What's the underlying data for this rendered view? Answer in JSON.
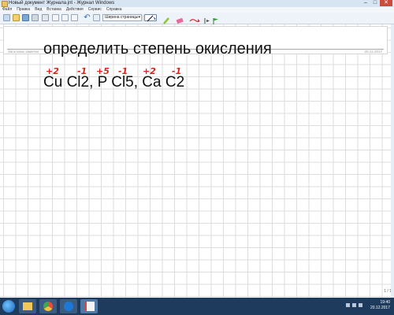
{
  "window": {
    "title": "Новый документ Журнала.jnt - Журнал Windows",
    "minimize": "–",
    "maximize": "□",
    "close": "✕"
  },
  "menu": [
    "Файл",
    "Правка",
    "Вид",
    "Вставка",
    "Действия",
    "Сервис",
    "Справка"
  ],
  "toolbar": {
    "zoom_label": "Ширина страницы",
    "icons": [
      "new-icon",
      "open-icon",
      "save-icon",
      "find-icon",
      "cut-icon",
      "copy-icon",
      "paste-icon",
      "undo-icon",
      "redo-icon",
      "pen-icon",
      "highlighter-icon",
      "eraser-icon",
      "selection-icon",
      "insert-space-icon",
      "flag-icon"
    ]
  },
  "note": {
    "title_placeholder": "Заголовок заметки",
    "date": "20.12.2017",
    "heading": "определить степень окисления",
    "formula": "Cu Cl2, P Cl5,  Ca C2",
    "oxidation_marks": [
      "+2",
      "-1",
      "+5",
      "-1",
      "+2",
      "-1"
    ],
    "ink_color": "#d9251c"
  },
  "status": {
    "page_indicator": "1 / 1"
  },
  "taskbar": {
    "time": "19:40",
    "date": "20.12.2017"
  }
}
